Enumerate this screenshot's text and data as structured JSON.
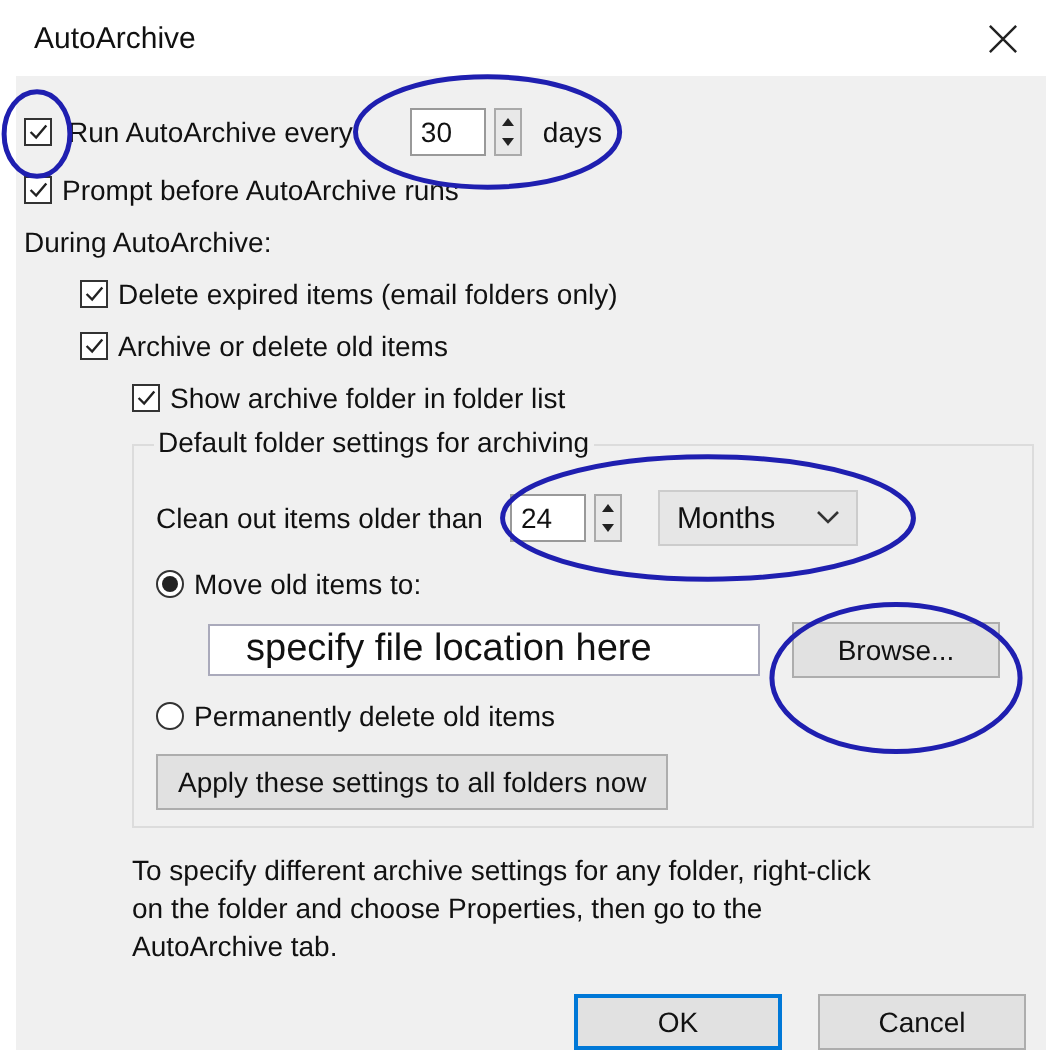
{
  "window": {
    "title": "AutoArchive"
  },
  "run": {
    "checked": true,
    "circled": true,
    "label": "Run AutoArchive every",
    "interval": {
      "value": "30",
      "unit": "days",
      "circled": true
    }
  },
  "prompt": {
    "checked": true,
    "label": "Prompt before AutoArchive runs"
  },
  "during_label": "During AutoArchive:",
  "delete_expired": {
    "checked": true,
    "label": "Delete expired items (email folders only)"
  },
  "archive_old": {
    "checked": true,
    "label": "Archive or delete old items"
  },
  "show_folder": {
    "checked": true,
    "label": "Show archive folder in folder list"
  },
  "defaults": {
    "title": "Default folder settings for archiving",
    "clean": {
      "label": "Clean out items older than",
      "value": "24",
      "unit": "Months",
      "circled": true
    },
    "options": [
      {
        "kind": "move",
        "label": "Move old items to:",
        "selected": true,
        "path": "specify file location here",
        "browse": {
          "label": "Browse...",
          "circled": true
        }
      },
      {
        "kind": "delete",
        "label": "Permanently delete old items",
        "selected": false
      }
    ],
    "apply_button": "Apply these settings to all folders now"
  },
  "note": "To specify different archive settings for any folder, right-click on the folder and choose Properties, then go to the AutoArchive tab.",
  "buttons": [
    {
      "label": "OK",
      "default": true
    },
    {
      "label": "Cancel",
      "default": false
    }
  ]
}
